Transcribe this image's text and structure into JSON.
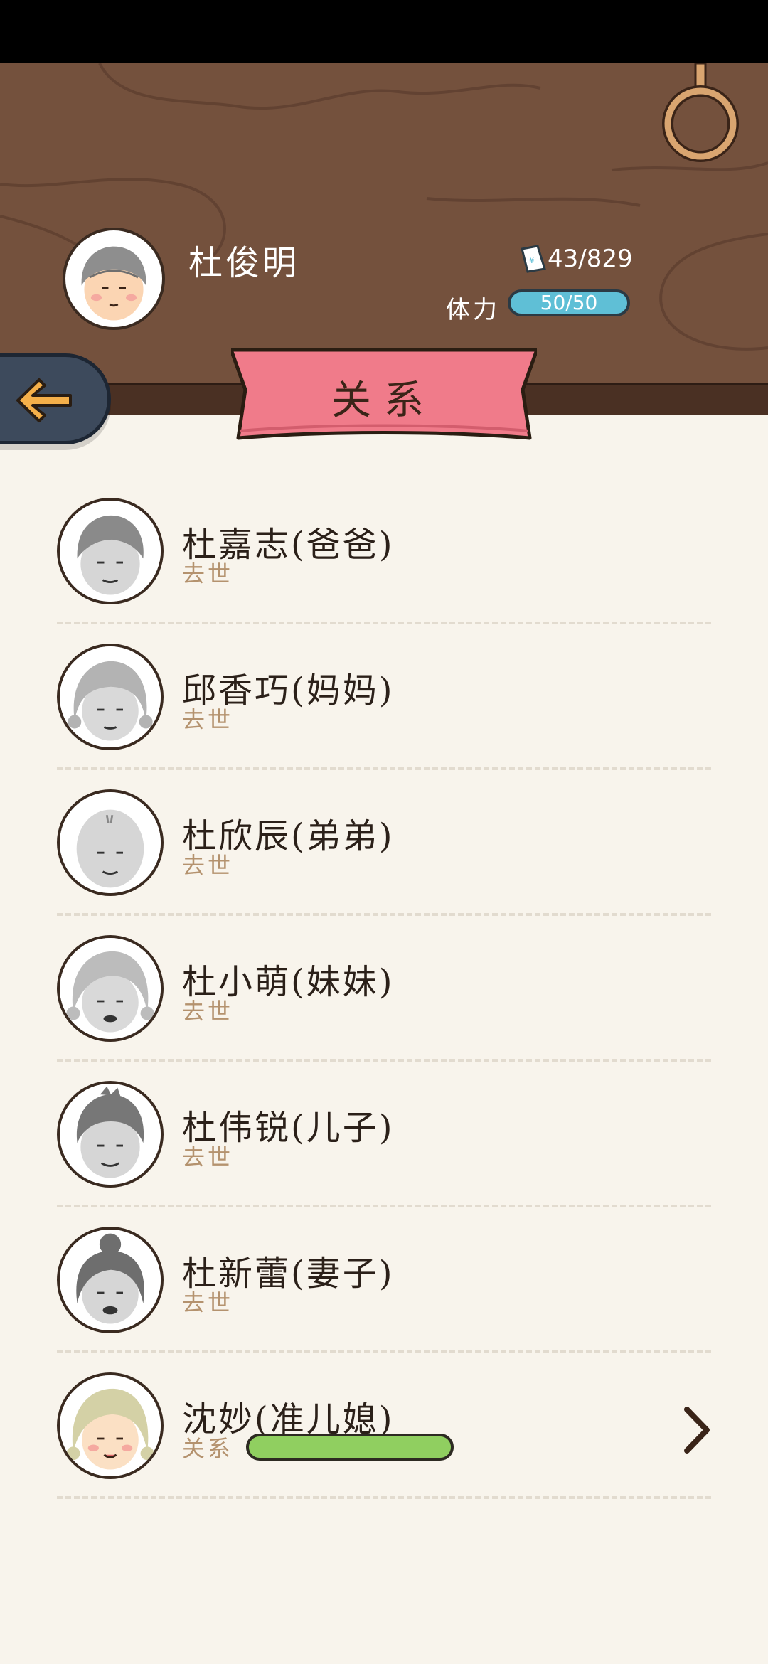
{
  "header": {
    "player_name": "杜俊明",
    "money": "43/829",
    "stamina_label": "体力",
    "stamina_value": "50/50",
    "title": "关系"
  },
  "colors": {
    "wood": "#74513d",
    "paper": "#f8f4ec",
    "banner": "#f07b8a",
    "stamina": "#5fbfd6",
    "relation_bar": "#90cf60",
    "status_text": "#b4926e"
  },
  "relations": [
    {
      "name": "杜嘉志(爸爸)",
      "status": "去世",
      "avatar": "old-man-gray"
    },
    {
      "name": "邱香巧(妈妈)",
      "status": "去世",
      "avatar": "old-woman-gray"
    },
    {
      "name": "杜欣辰(弟弟)",
      "status": "去世",
      "avatar": "bald-old-man-gray"
    },
    {
      "name": "杜小萌(妹妹)",
      "status": "去世",
      "avatar": "old-woman-gray"
    },
    {
      "name": "杜伟锐(儿子)",
      "status": "去世",
      "avatar": "old-man-gray"
    },
    {
      "name": "杜新蕾(妻子)",
      "status": "去世",
      "avatar": "old-woman-bun-gray"
    },
    {
      "name": "沈妙(准儿媳)",
      "status": "关系",
      "avatar": "young-woman-color",
      "relation_level": 1.0
    }
  ]
}
